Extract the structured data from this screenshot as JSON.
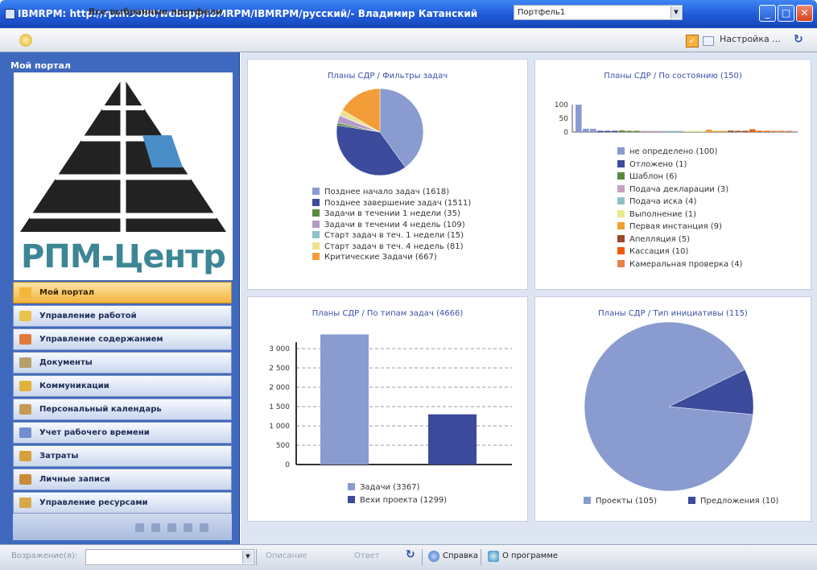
{
  "window": {
    "title": "IBMRPM: http://rpm:9080/webapp/IBMRPM/IBMRPM/русский/- Владимир Катанский",
    "min": "_",
    "max": "□",
    "close": "✕"
  },
  "toolbar": {
    "label": "Все выбранные портфели",
    "portfolio": "Портфель1",
    "settings": "Настройка ..."
  },
  "sidebar": {
    "header": "Мой портал",
    "logo_text": "РПМ-Центр",
    "items": [
      {
        "label": "Мой портал",
        "color": "#f5b638"
      },
      {
        "label": "Управление работой",
        "color": "#e8c24a"
      },
      {
        "label": "Управление содержанием",
        "color": "#e07a3a"
      },
      {
        "label": "Документы",
        "color": "#b4a06a"
      },
      {
        "label": "Коммуникации",
        "color": "#e2b23a"
      },
      {
        "label": "Персональный календарь",
        "color": "#c69a52"
      },
      {
        "label": "Учет рабочего времени",
        "color": "#6f8fd0"
      },
      {
        "label": "Затраты",
        "color": "#d8a03c"
      },
      {
        "label": "Личные записи",
        "color": "#c98a3a"
      },
      {
        "label": "Управление ресурсами",
        "color": "#d9a84a"
      }
    ]
  },
  "status": {
    "label": "Возражение(я):",
    "describe": "Описание",
    "answer": "Ответ",
    "help": "Справка",
    "about": "О программе"
  },
  "chart_data": [
    {
      "type": "pie",
      "title": "Планы СДР / Фильтры задач",
      "series": [
        {
          "name": "Позднее начало задач (1618)",
          "value": 1618,
          "color": "#8a9bd0"
        },
        {
          "name": "Позднее завершение задач (1511)",
          "value": 1511,
          "color": "#3c4b9c"
        },
        {
          "name": "Задачи в течении 1 недели (35)",
          "value": 35,
          "color": "#5a8a3c"
        },
        {
          "name": "Задачи в течении 4 недель (109)",
          "value": 109,
          "color": "#b49ac8"
        },
        {
          "name": "Старт задач в теч. 1 недели (15)",
          "value": 15,
          "color": "#8fc0c8"
        },
        {
          "name": "Старт задач в теч. 4 недель (81)",
          "value": 81,
          "color": "#f0e08c"
        },
        {
          "name": "Критические Задачи (667)",
          "value": 667,
          "color": "#f29d38"
        }
      ]
    },
    {
      "type": "bar",
      "title": "Планы СДР / По состоянию (150)",
      "ylim": [
        0,
        100
      ],
      "yticks": [
        "100",
        "50",
        "0"
      ],
      "series": [
        {
          "name": "не определено (100)",
          "value": 100,
          "color": "#8a9bd0"
        },
        {
          "name": "Отложено (1)",
          "value": 1,
          "color": "#3c4b9c"
        },
        {
          "name": "Шаблон (6)",
          "value": 6,
          "color": "#5a8a3c"
        },
        {
          "name": "Подача декларации (3)",
          "value": 3,
          "color": "#c9a0c0"
        },
        {
          "name": "Подача иска (4)",
          "value": 4,
          "color": "#8fc0c8"
        },
        {
          "name": "Выполнение (1)",
          "value": 1,
          "color": "#e8e88c"
        },
        {
          "name": "Первая инстанция (9)",
          "value": 9,
          "color": "#f0a030"
        },
        {
          "name": "Апелляция (5)",
          "value": 5,
          "color": "#9a4a2a"
        },
        {
          "name": "Кассация (10)",
          "value": 10,
          "color": "#f25a00"
        },
        {
          "name": "Камеральная проверка (4)",
          "value": 4,
          "color": "#e8804a"
        }
      ]
    },
    {
      "type": "bar",
      "title": "Планы СДР / По типам задач (4666)",
      "ylim": [
        0,
        3000
      ],
      "yticks": [
        "3 000",
        "2 500",
        "2 000",
        "1 500",
        "1 000",
        "500",
        "0"
      ],
      "series": [
        {
          "name": "Задачи (3367)",
          "value": 3367,
          "color": "#8a9bd0"
        },
        {
          "name": "Вехи проекта (1299)",
          "value": 1299,
          "color": "#3c4b9c"
        }
      ]
    },
    {
      "type": "pie",
      "title": "Планы СДР / Тип инициативы (115)",
      "series": [
        {
          "name": "Проекты (105)",
          "value": 105,
          "color": "#8a9bd0"
        },
        {
          "name": "Предложения (10)",
          "value": 10,
          "color": "#3c4b9c"
        }
      ]
    }
  ]
}
